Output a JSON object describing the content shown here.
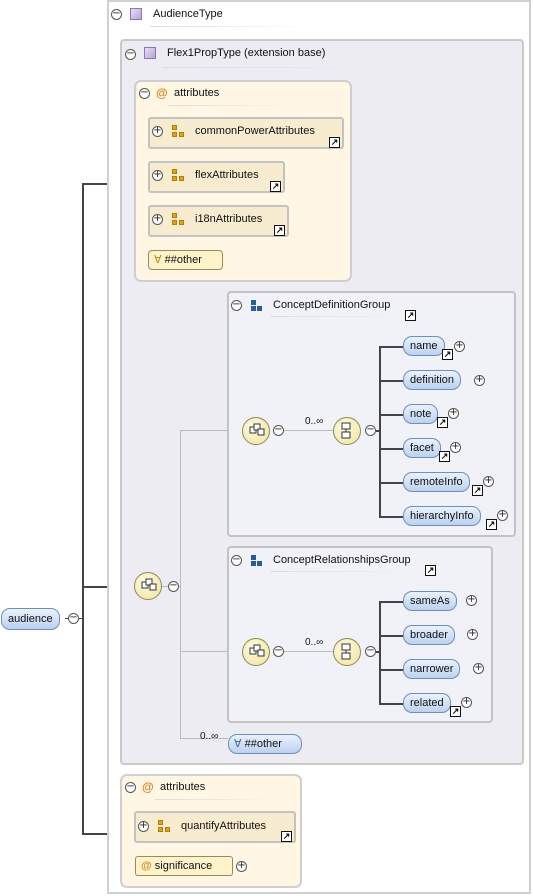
{
  "root_element": {
    "label": "audience"
  },
  "complex_type": {
    "label": "AudienceType"
  },
  "extension": {
    "label": "Flex1PropType (extension base)"
  },
  "attributes_top": {
    "label": "attributes",
    "groups": [
      "commonPowerAttributes",
      "flexAttributes",
      "i18nAttributes"
    ],
    "any_attribute": "##other"
  },
  "group1": {
    "label": "ConceptDefinitionGroup",
    "cardinality": "0..∞",
    "elements": [
      "name",
      "definition",
      "note",
      "facet",
      "remoteInfo",
      "hierarchyInfo"
    ]
  },
  "group2": {
    "label": "ConceptRelationshipsGroup",
    "cardinality": "0..∞",
    "elements": [
      "sameAs",
      "broader",
      "narrower",
      "related"
    ]
  },
  "any_element": {
    "cardinality": "0..∞",
    "label": "##other"
  },
  "attributes_bottom": {
    "label": "attributes",
    "group": "quantifyAttributes",
    "attribute": "significance"
  },
  "symbols": {
    "minus": "−",
    "plus": "+",
    "forall": "∀",
    "at": "@",
    "link": "↗"
  },
  "colors": {
    "element_fill": "#bcd1ee",
    "attribute_panel": "#fff6e4",
    "group_icon": "#e0a21a"
  }
}
